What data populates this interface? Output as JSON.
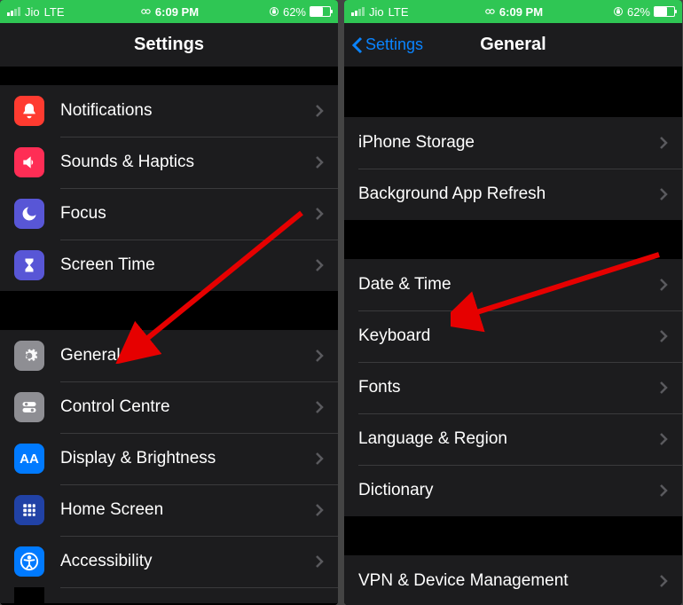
{
  "status": {
    "carrier": "Jio",
    "network": "LTE",
    "time": "6:09 PM",
    "battery_pct": "62%"
  },
  "left": {
    "title": "Settings",
    "groups": [
      {
        "rows": [
          {
            "id": "notifications",
            "label": "Notifications",
            "icon_bg": "#ff3b30",
            "icon": "bell"
          },
          {
            "id": "sounds",
            "label": "Sounds & Haptics",
            "icon_bg": "#ff2d55",
            "icon": "speaker"
          },
          {
            "id": "focus",
            "label": "Focus",
            "icon_bg": "#5856d6",
            "icon": "moon"
          },
          {
            "id": "screentime",
            "label": "Screen Time",
            "icon_bg": "#5856d6",
            "icon": "hourglass"
          }
        ]
      },
      {
        "rows": [
          {
            "id": "general",
            "label": "General",
            "icon_bg": "#8e8e93",
            "icon": "gear"
          },
          {
            "id": "control",
            "label": "Control Centre",
            "icon_bg": "#8e8e93",
            "icon": "toggles"
          },
          {
            "id": "display",
            "label": "Display & Brightness",
            "icon_bg": "#007aff",
            "icon": "aa"
          },
          {
            "id": "home",
            "label": "Home Screen",
            "icon_bg": "#3355cc",
            "icon": "grid"
          },
          {
            "id": "accessibility",
            "label": "Accessibility",
            "icon_bg": "#007aff",
            "icon": "person"
          }
        ]
      }
    ]
  },
  "right": {
    "back": "Settings",
    "title": "General",
    "groups": [
      {
        "rows": [
          {
            "id": "storage",
            "label": "iPhone Storage"
          },
          {
            "id": "bgrefresh",
            "label": "Background App Refresh"
          }
        ]
      },
      {
        "rows": [
          {
            "id": "datetime",
            "label": "Date & Time"
          },
          {
            "id": "keyboard",
            "label": "Keyboard"
          },
          {
            "id": "fonts",
            "label": "Fonts"
          },
          {
            "id": "langregion",
            "label": "Language & Region"
          },
          {
            "id": "dictionary",
            "label": "Dictionary"
          }
        ]
      },
      {
        "rows": [
          {
            "id": "vpn",
            "label": "VPN & Device Management"
          }
        ]
      }
    ]
  }
}
